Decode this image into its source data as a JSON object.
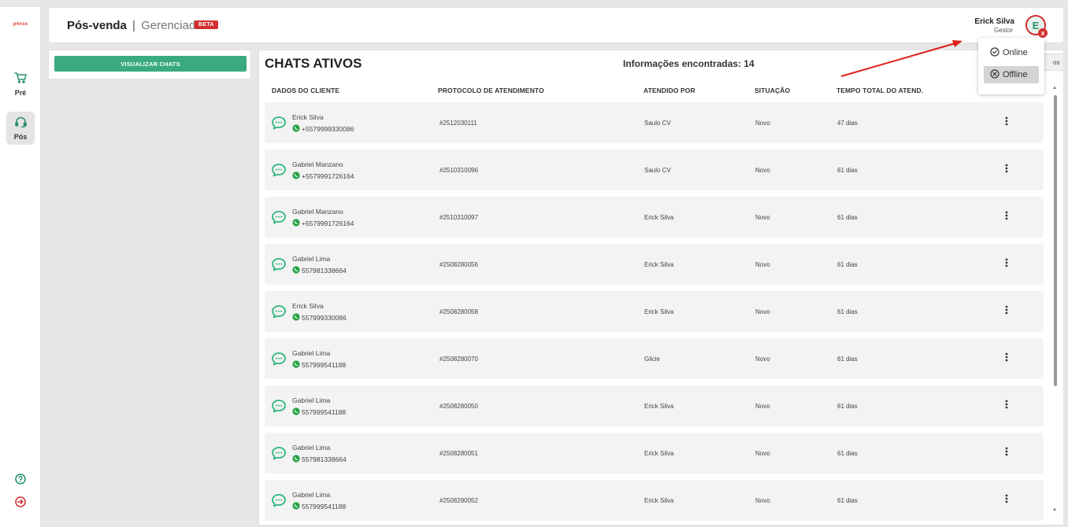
{
  "brand": {
    "logo_text": "p4nse"
  },
  "sidebar": {
    "items": [
      {
        "label": "Pré",
        "icon": "cart-icon"
      },
      {
        "label": "Pós",
        "icon": "headset-icon",
        "active": true
      }
    ],
    "bottom": [
      {
        "icon": "help-icon"
      },
      {
        "icon": "logout-icon"
      }
    ]
  },
  "header": {
    "title": "Pós-venda",
    "separator": "|",
    "subtitle": "Gerenciador",
    "badge": "BETA",
    "user": {
      "name": "Erick Silva",
      "role": "Gestor",
      "initial": "E",
      "status_badge": "x"
    }
  },
  "left_panel": {
    "button_label": "VISUALIZAR CHATS"
  },
  "main": {
    "heading": "CHATS ATIVOS",
    "info": "Informações encontradas: 14",
    "cut_button": "os",
    "columns": [
      "DADOS DO CLIENTE",
      "PROTOCOLO DE ATENDIMENTO",
      "ATENDIDO POR",
      "SITUAÇÃO",
      "TEMPO TOTAL DO ATEND."
    ],
    "rows": [
      {
        "name": "Erick Silva",
        "phone": "+5579999330086",
        "protocol": "#2512030111",
        "agent": "Saulo CV",
        "status": "Novo",
        "time": "47 dias"
      },
      {
        "name": "Gabriel Manzano",
        "phone": "+5579991726164",
        "protocol": "#2510310096",
        "agent": "Saulo CV",
        "status": "Novo",
        "time": "61 dias"
      },
      {
        "name": "Gabriel Manzano",
        "phone": "+5579991726164",
        "protocol": "#2510310097",
        "agent": "Erick Silva",
        "status": "Novo",
        "time": "61 dias"
      },
      {
        "name": "Gabriel Lima",
        "phone": "557981338664",
        "protocol": "#2508280056",
        "agent": "Erick Silva",
        "status": "Novo",
        "time": "61 dias"
      },
      {
        "name": "Erick Silva",
        "phone": "557999330086",
        "protocol": "#2508280058",
        "agent": "Erick Silva",
        "status": "Novo",
        "time": "61 dias"
      },
      {
        "name": "Gabriel Lima",
        "phone": "557999541188",
        "protocol": "#2508280070",
        "agent": "Gilcie",
        "status": "Novo",
        "time": "61 dias"
      },
      {
        "name": "Gabriel Lima",
        "phone": "557999541188",
        "protocol": "#2508280050",
        "agent": "Erick Silva",
        "status": "Novo",
        "time": "61 dias"
      },
      {
        "name": "Gabriel Lima",
        "phone": "557981338664",
        "protocol": "#2508280051",
        "agent": "Erick Silva",
        "status": "Novo",
        "time": "61 dias"
      },
      {
        "name": "Gabriel Lima",
        "phone": "557999541188",
        "protocol": "#2508280052",
        "agent": "Erick Silva",
        "status": "Novo",
        "time": "61 dias"
      }
    ]
  },
  "status_menu": {
    "options": [
      {
        "label": "Online",
        "icon": "check-circle-icon"
      },
      {
        "label": "Offline",
        "icon": "x-circle-icon",
        "selected": true
      }
    ]
  },
  "colors": {
    "accent_green": "#3aaa80",
    "badge_red": "#d32f2f",
    "chat_icon": "#2eb67d",
    "whatsapp": "#25a244",
    "annotation_arrow": "#e0201a"
  }
}
